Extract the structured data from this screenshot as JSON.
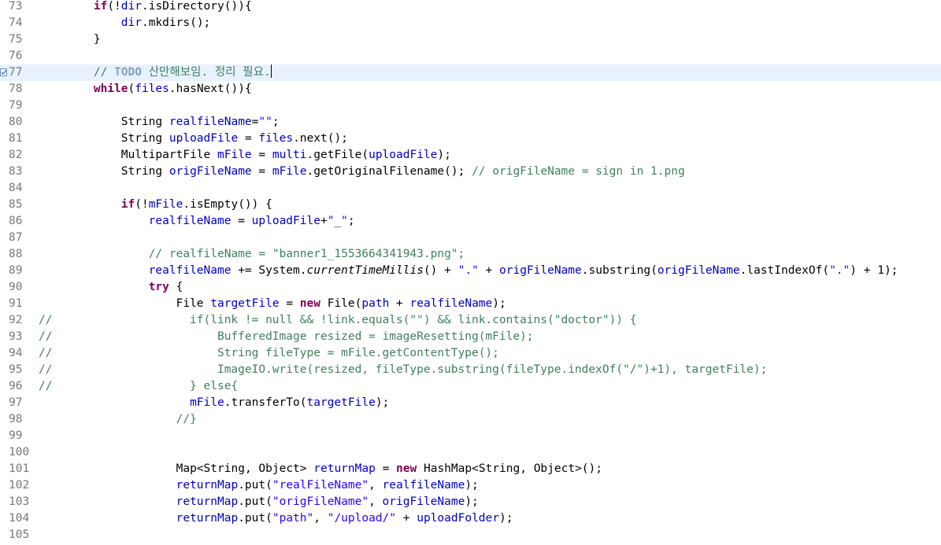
{
  "editor": {
    "current_line": "77",
    "lines": [
      {
        "n": "73",
        "t": "        if(!dir.isDirectory()){"
      },
      {
        "n": "74",
        "t": "            dir.mkdirs();"
      },
      {
        "n": "75",
        "t": "        }"
      },
      {
        "n": "76",
        "t": ""
      },
      {
        "n": "77",
        "t": "        // TODO 산만해보임. 정리 필요."
      },
      {
        "n": "78",
        "t": "        while(files.hasNext()){"
      },
      {
        "n": "79",
        "t": ""
      },
      {
        "n": "80",
        "t": "            String realfileName=\"\";"
      },
      {
        "n": "81",
        "t": "            String uploadFile = files.next();"
      },
      {
        "n": "82",
        "t": "            MultipartFile mFile = multi.getFile(uploadFile);"
      },
      {
        "n": "83",
        "t": "            String origFileName = mFile.getOriginalFilename(); // origFileName = sign in 1.png"
      },
      {
        "n": "84",
        "t": ""
      },
      {
        "n": "85",
        "t": "            if(!mFile.isEmpty()) {"
      },
      {
        "n": "86",
        "t": "                realfileName = uploadFile+\"_\";"
      },
      {
        "n": "87",
        "t": ""
      },
      {
        "n": "88",
        "t": "                // realfileName = \"banner1_1553664341943.png\";"
      },
      {
        "n": "89",
        "t": "                realfileName += System.currentTimeMillis() + \".\" + origFileName.substring(origFileName.lastIndexOf(\".\") + 1);"
      },
      {
        "n": "90",
        "t": "                try {"
      },
      {
        "n": "91",
        "t": "                    File targetFile = new File(path + realfileName);"
      },
      {
        "n": "92",
        "t": "//                    if(link != null && !link.equals(\"\") && link.contains(\"doctor\")) {"
      },
      {
        "n": "93",
        "t": "//                        BufferedImage resized = imageResetting(mFile);"
      },
      {
        "n": "94",
        "t": "//                        String fileType = mFile.getContentType();"
      },
      {
        "n": "95",
        "t": "//                        ImageIO.write(resized, fileType.substring(fileType.indexOf(\"/\")+1), targetFile);"
      },
      {
        "n": "96",
        "t": "//                    } else{"
      },
      {
        "n": "97",
        "t": "                      mFile.transferTo(targetFile);"
      },
      {
        "n": "98",
        "t": "                    //}"
      },
      {
        "n": "99",
        "t": ""
      },
      {
        "n": "100",
        "t": ""
      },
      {
        "n": "101",
        "t": "                    Map<String, Object> returnMap = new HashMap<String, Object>();"
      },
      {
        "n": "102",
        "t": "                    returnMap.put(\"realFileName\", realfileName);"
      },
      {
        "n": "103",
        "t": "                    returnMap.put(\"origFileName\", origFileName);"
      },
      {
        "n": "104",
        "t": "                    returnMap.put(\"path\", \"/upload/\" + uploadFolder);"
      },
      {
        "n": "105",
        "t": ""
      }
    ]
  },
  "colors": {
    "keyword": "#7f0055",
    "field": "#0000c0",
    "string": "#2a00ff",
    "comment": "#3f7f5f",
    "todo": "#7f9fbf",
    "line_number": "#787878",
    "current_line_bg": "#e8f2fe"
  },
  "icons": {
    "task_marker": "todo-task-icon"
  }
}
